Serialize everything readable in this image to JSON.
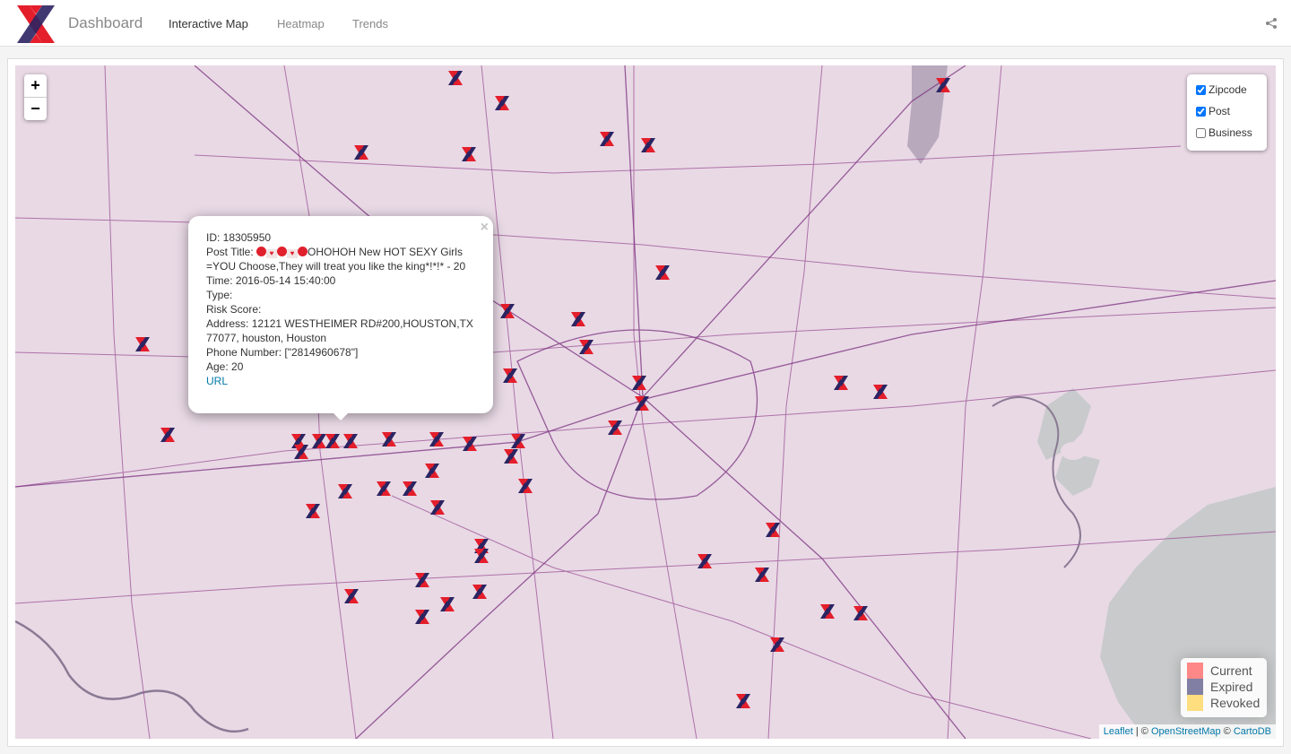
{
  "app": {
    "brand": "Dashboard",
    "nav": [
      {
        "label": "Interactive Map",
        "active": true
      },
      {
        "label": "Heatmap",
        "active": false
      },
      {
        "label": "Trends",
        "active": false
      }
    ],
    "share_icon": "share-icon",
    "colors": {
      "logo_red": "#e41e2b",
      "logo_navy": "#2b2462"
    }
  },
  "map": {
    "zoom_in": "+",
    "zoom_out": "−",
    "layers": [
      {
        "label": "Zipcode",
        "checked": true
      },
      {
        "label": "Post",
        "checked": true
      },
      {
        "label": "Business",
        "checked": false
      }
    ],
    "legend": [
      {
        "label": "Current",
        "color": "#ff5555"
      },
      {
        "label": "Expired",
        "color": "#4d4a7e"
      },
      {
        "label": "Revoked",
        "color": "#ffd24a"
      }
    ],
    "attribution": {
      "leaflet": "Leaflet",
      "sep1": " | © ",
      "osm": "OpenStreetMap",
      "sep2": " © ",
      "carto": "CartoDB"
    }
  },
  "popup": {
    "id_line": "ID: 18305950",
    "title_label": "Post Title: ",
    "title_text": "OHOHOH New HOT SEXY Girls =YOU Choose,They will treat you like the king*!*!* - 20",
    "time_line": "Time: 2016-05-14 15:40:00",
    "type_line": "Type:",
    "risk_line": "Risk Score:",
    "address_line": "Address: 12121 WESTHEIMER RD#200,HOUSTON,TX 77077, houston, Houston",
    "phone_line": "Phone Number: [\"2814960678\"]",
    "age_line": "Age: 20",
    "url_label": "URL",
    "close": "×"
  }
}
